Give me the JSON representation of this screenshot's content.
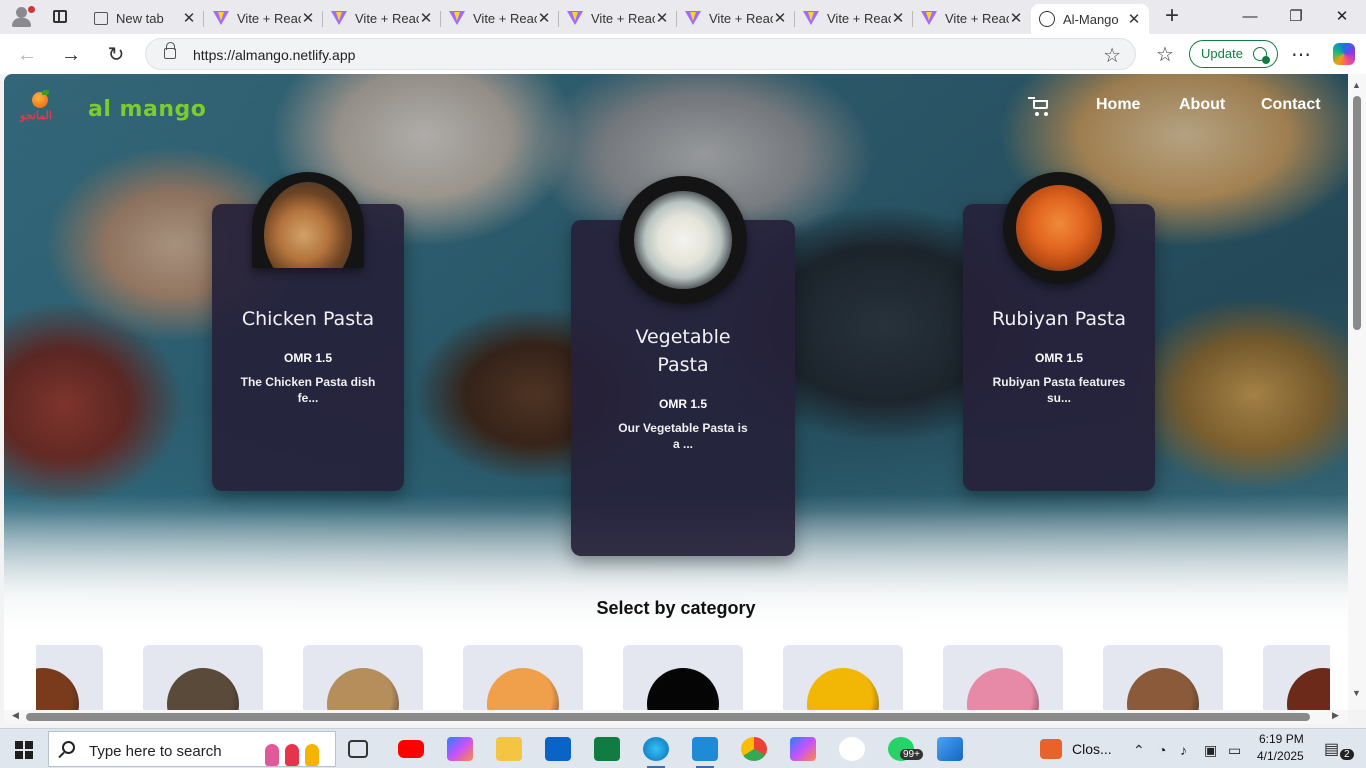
{
  "browser": {
    "tabs": [
      {
        "title": "New tab",
        "icon": "new-tab-icon",
        "active": false
      },
      {
        "title": "Vite + React",
        "icon": "vite-icon",
        "active": false
      },
      {
        "title": "Vite + React",
        "icon": "vite-icon",
        "active": false
      },
      {
        "title": "Vite + React",
        "icon": "vite-icon",
        "active": false
      },
      {
        "title": "Vite + React",
        "icon": "vite-icon",
        "active": false
      },
      {
        "title": "Vite + React",
        "icon": "vite-icon",
        "active": false
      },
      {
        "title": "Vite + React",
        "icon": "vite-icon",
        "active": false
      },
      {
        "title": "Vite + React",
        "icon": "vite-icon",
        "active": false
      },
      {
        "title": "Al-Mango",
        "icon": "globe-icon",
        "active": true
      }
    ],
    "close_glyph": "✕",
    "new_tab_glyph": "+",
    "window_controls": {
      "minimize": "—",
      "maximize": "❐",
      "close": "✕"
    },
    "url": "https://almango.netlify.app",
    "update_label": "Update",
    "nav_glyphs": {
      "back": "←",
      "forward": "→",
      "refresh": "↻",
      "star": "☆",
      "favorites": "☆",
      "more": "⋯"
    }
  },
  "site": {
    "logo_arabic": "المانجو",
    "logo_text": "al mango",
    "nav": {
      "home": "Home",
      "about": "About",
      "contact": "Contact"
    },
    "featured": [
      {
        "name": "Chicken Pasta",
        "price": "OMR 1.5",
        "description": "The Chicken Pasta dish fe..."
      },
      {
        "name": "Vegetable Pasta",
        "price": "OMR 1.5",
        "description": "Our Vegetable Pasta is a ..."
      },
      {
        "name": "Rubiyan Pasta",
        "price": "OMR 1.5",
        "description": "Rubiyan Pasta features su..."
      }
    ],
    "category_title": "Select by category",
    "categories": [
      {
        "icon": "burger-thumb",
        "color": "#7a3b1d"
      },
      {
        "icon": "pasta-bowl-thumb",
        "color": "#5a4a3a"
      },
      {
        "icon": "wrap-thumb",
        "color": "#b58e5c"
      },
      {
        "icon": "fries-thumb",
        "color": "#f0a04b"
      },
      {
        "icon": "dark-thumb",
        "color": "#050505"
      },
      {
        "icon": "mango-juice-thumb",
        "color": "#f2b705"
      },
      {
        "icon": "pink-shake-thumb",
        "color": "#e78aa8"
      },
      {
        "icon": "coffee-shake-thumb",
        "color": "#8a5a3a"
      },
      {
        "icon": "platter-thumb",
        "color": "#6b2a1a"
      }
    ]
  },
  "taskbar": {
    "search_placeholder": "Type here to search",
    "tray_app_label": "Clos...",
    "whatsapp_badge": "99+",
    "notification_count": "2",
    "time": "6:19 PM",
    "date": "4/1/2025"
  }
}
